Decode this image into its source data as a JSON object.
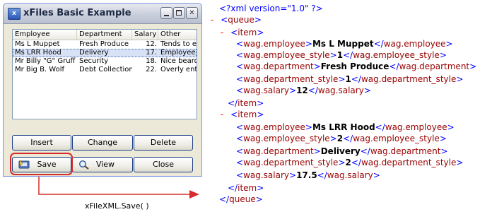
{
  "window": {
    "title": "xFiles Basic Example",
    "icon": "xfiles-app-icon"
  },
  "listview": {
    "columns": [
      "Employee",
      "Department",
      "Salary",
      "Other"
    ],
    "rows": [
      {
        "employee": "Ms L Muppet",
        "department": "Fresh Produce",
        "salary": "12.",
        "other": "Tends to e",
        "selected": false
      },
      {
        "employee": "Ms LRR Hood",
        "department": "Delivery",
        "salary": "17.",
        "other": "Employee i",
        "selected": true
      },
      {
        "employee": "Mr Billy \"G\" Gruff",
        "department": "Security",
        "salary": "18.",
        "other": "Nice beard",
        "selected": false
      },
      {
        "employee": "Mr Big B. Wolf",
        "department": "Debt Collection",
        "salary": "22.",
        "other": "Overly ent",
        "selected": false
      }
    ]
  },
  "buttons": {
    "insert": "Insert",
    "change": "Change",
    "delete": "Delete",
    "save": "Save",
    "view": "View",
    "close": "Close"
  },
  "caption": "xFileXML.Save( )",
  "xml": {
    "declaration": "<?xml version=\"1.0\" ?>",
    "root": "queue",
    "item_tag": "item",
    "items": [
      {
        "fields": [
          {
            "tag": "wag.employee",
            "value": "Ms L Muppet"
          },
          {
            "tag": "wag.employee_style",
            "value": "1"
          },
          {
            "tag": "wag.department",
            "value": "Fresh Produce"
          },
          {
            "tag": "wag.department_style",
            "value": "1"
          },
          {
            "tag": "wag.salary",
            "value": "12"
          }
        ]
      },
      {
        "fields": [
          {
            "tag": "wag.employee",
            "value": "Ms LRR Hood"
          },
          {
            "tag": "wag.employee_style",
            "value": "2"
          },
          {
            "tag": "wag.department",
            "value": "Delivery"
          },
          {
            "tag": "wag.department_style",
            "value": "2"
          },
          {
            "tag": "wag.salary",
            "value": "17.5"
          }
        ]
      }
    ],
    "collapse_symbol": "-"
  },
  "colors": {
    "xml_tag": "#990000",
    "xml_bracket": "#0000ff",
    "collapse": "#ff0000",
    "highlight": "#d62c2c"
  }
}
